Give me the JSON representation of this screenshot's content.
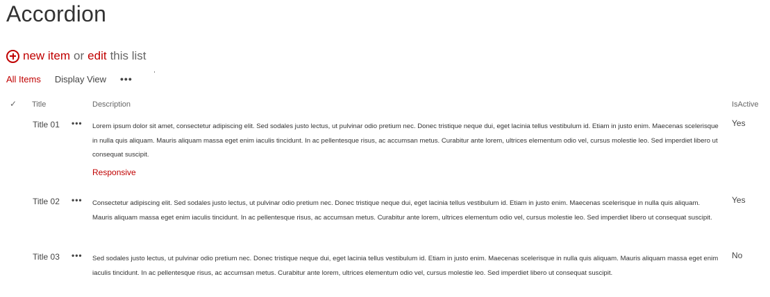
{
  "page": {
    "title": "Accordion"
  },
  "toolbar": {
    "new_item": "new item",
    "or": "or",
    "edit": "edit",
    "this_list": "this list"
  },
  "views": {
    "all_items": "All Items",
    "display_view": "Display View",
    "more": "•••"
  },
  "columns": {
    "title": "Title",
    "description": "Description",
    "is_active": "IsActive"
  },
  "rows": [
    {
      "title": "Title 01",
      "menu": "•••",
      "description": "Lorem ipsum dolor sit amet, consectetur adipiscing elit. Sed sodales justo lectus, ut pulvinar odio pretium nec. Donec tristique neque dui, eget lacinia tellus vestibulum id. Etiam in justo enim. Maecenas scelerisque in nulla quis aliquam. Mauris aliquam massa eget enim iaculis tincidunt. In ac pellentesque risus, ac accumsan metus. Curabitur ante lorem, ultrices elementum odio vel, cursus molestie leo. Sed imperdiet libero ut consequat suscipit.",
      "link": "Responsive",
      "is_active": "Yes"
    },
    {
      "title": "Title 02",
      "menu": "•••",
      "description": "Consectetur adipiscing elit. Sed sodales justo lectus, ut pulvinar odio pretium nec. Donec tristique neque dui, eget lacinia tellus vestibulum id. Etiam in justo enim. Maecenas scelerisque in nulla quis aliquam. Mauris aliquam massa eget enim iaculis tincidunt. In ac pellentesque risus, ac accumsan metus. Curabitur ante lorem, ultrices elementum odio vel, cursus molestie leo. Sed imperdiet libero ut consequat suscipit.",
      "is_active": "Yes"
    },
    {
      "title": "Title 03",
      "menu": "•••",
      "description": "Sed sodales justo lectus, ut pulvinar odio pretium nec. Donec tristique neque dui, eget lacinia tellus vestibulum id. Etiam in justo enim. Maecenas scelerisque in nulla quis aliquam. Mauris aliquam massa eget enim iaculis tincidunt. In ac pellentesque risus, ac accumsan metus. Curabitur ante lorem, ultrices elementum odio vel, cursus molestie leo. Sed imperdiet libero ut consequat suscipit.",
      "is_active": "No"
    }
  ],
  "icons": {
    "new_item": "plus-circle-icon",
    "select_all": "checkmark-icon"
  },
  "colors": {
    "accent": "#c00000",
    "text": "#444444"
  }
}
